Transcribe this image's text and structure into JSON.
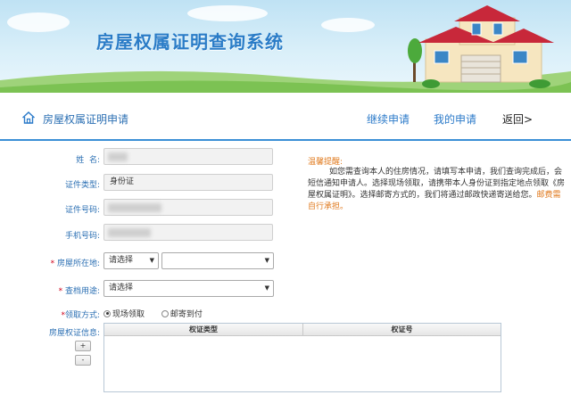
{
  "banner": {
    "title": "房屋权属证明查询系统"
  },
  "nav": {
    "page_title": "房屋权属证明申请",
    "continue_label": "继续申请",
    "my_apply_label": "我的申请",
    "back_label": "返回>"
  },
  "form": {
    "name_label": "姓  名:",
    "id_type_label": "证件类型:",
    "id_type_value": "身份证",
    "id_number_label": "证件号码:",
    "phone_label": "手机号码:",
    "location_label": "房屋所在地:",
    "location_select": "请选择",
    "purpose_label": "查档用途:",
    "purpose_select": "请选择",
    "pickup_label": "领取方式:",
    "pickup_options": [
      "现场领取",
      "邮寄到付"
    ],
    "cert_label": "房屋权证信息:",
    "add_label": "+",
    "remove_label": "-",
    "table_headers": [
      "权证类型",
      "权证号"
    ],
    "required_mark": "*"
  },
  "tips": {
    "title": "温馨提醒:",
    "body": "如您需查询本人的住房情况，请填写本申请，我们查询完成后，会短信通知申请人。选择现场领取，请携带本人身份证到指定地点领取《房屋权属证明》。选择邮寄方式的，我们将通过邮政快递寄送给您。",
    "highlight": "邮费需自行承担。"
  },
  "colors": {
    "accent_blue": "#2b7ac9",
    "tip_orange": "#e07a1e",
    "required_red": "#d0021b"
  }
}
